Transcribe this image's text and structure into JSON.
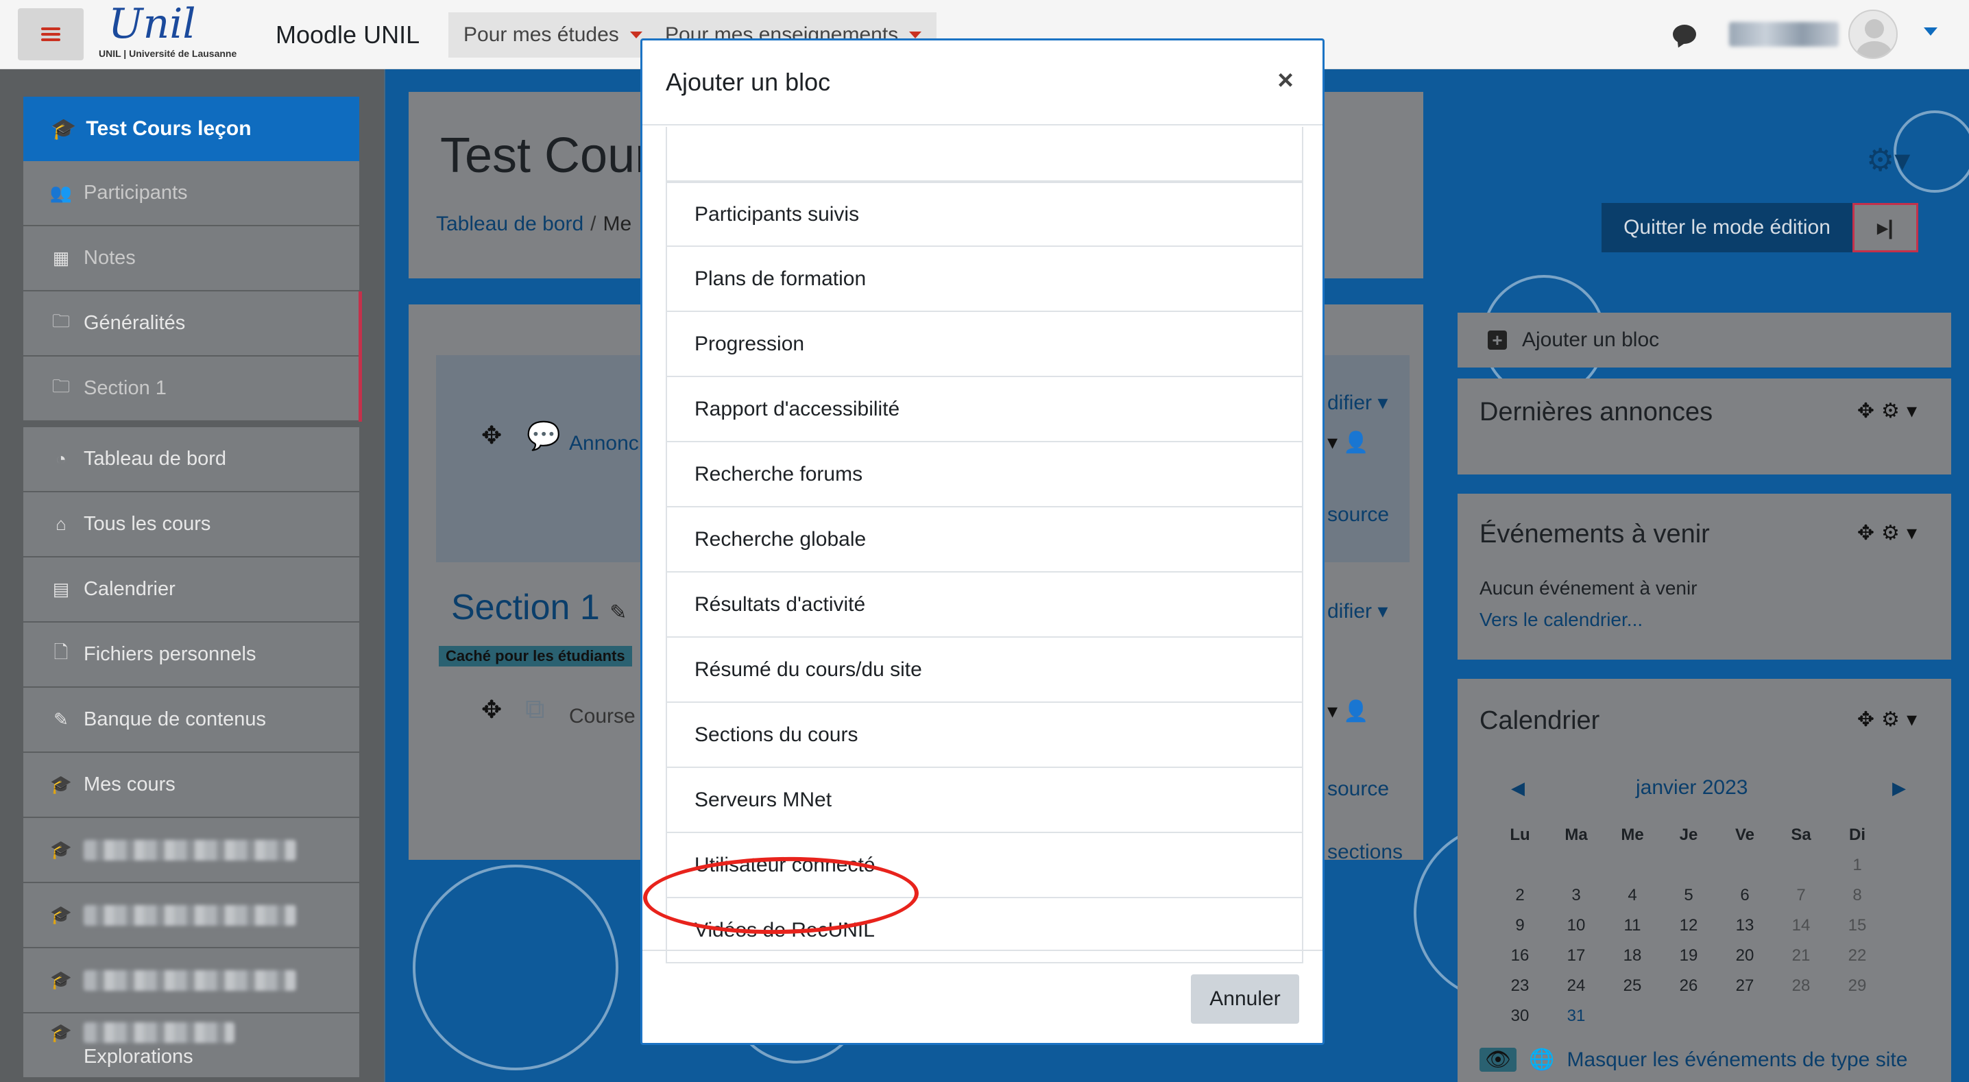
{
  "navbar": {
    "logo_text": "Unil",
    "logo_sub": "UNIL | Université de Lausanne",
    "site_name": "Moodle UNIL",
    "menu": [
      "Pour mes études",
      "Pour mes enseignements"
    ]
  },
  "drawer": {
    "course_title": "Test Cours leçon",
    "course_items": [
      {
        "label": "Participants",
        "icon": "users-icon"
      },
      {
        "label": "Notes",
        "icon": "table-icon"
      },
      {
        "label": "Généralités",
        "icon": "folder-icon"
      },
      {
        "label": "Section 1",
        "icon": "folder-icon"
      }
    ],
    "site_items": [
      {
        "label": "Tableau de bord",
        "icon": "dashboard-icon"
      },
      {
        "label": "Tous les cours",
        "icon": "home-icon"
      },
      {
        "label": "Calendrier",
        "icon": "calendar-icon"
      },
      {
        "label": "Fichiers personnels",
        "icon": "file-icon"
      },
      {
        "label": "Banque de contenus",
        "icon": "brush-icon"
      },
      {
        "label": "Mes cours",
        "icon": "graduation-cap-icon"
      }
    ],
    "last_item_label": "Explorations"
  },
  "page": {
    "course_title": "Test Cour",
    "breadcrumb_home": "Tableau de bord",
    "breadcrumb_next": "Me",
    "quit_edit": "Quitter le mode édition",
    "announcements_link": "Annonc",
    "section_title": "Section 1",
    "hidden_badge": "Caché pour les étudiants",
    "course_link": "Course",
    "right_modifier": "difier",
    "right_source": "source",
    "right_sections": "sections"
  },
  "blocks": {
    "add_block": "Ajouter un bloc",
    "announcements_title": "Dernières annonces",
    "events_title": "Événements à venir",
    "events_empty": "Aucun événement à venir",
    "events_link": "Vers le calendrier...",
    "calendar_title": "Calendrier",
    "calendar_month": "janvier 2023",
    "calendar_days": [
      "Lu",
      "Ma",
      "Me",
      "Je",
      "Ve",
      "Sa",
      "Di"
    ],
    "calendar_weeks": [
      [
        "",
        "",
        "",
        "",
        "",
        "",
        "1"
      ],
      [
        "2",
        "3",
        "4",
        "5",
        "6",
        "7",
        "8"
      ],
      [
        "9",
        "10",
        "11",
        "12",
        "13",
        "14",
        "15"
      ],
      [
        "16",
        "17",
        "18",
        "19",
        "20",
        "21",
        "22"
      ],
      [
        "23",
        "24",
        "25",
        "26",
        "27",
        "28",
        "29"
      ],
      [
        "30",
        "31",
        "",
        "",
        "",
        "",
        ""
      ]
    ],
    "hide_site_events": "Masquer les événements de type site"
  },
  "modal": {
    "title": "Ajouter un bloc",
    "close_symbol": "×",
    "items": [
      "Participants suivis",
      "Plans de formation",
      "Progression",
      "Rapport d'accessibilité",
      "Recherche forums",
      "Recherche globale",
      "Résultats d'activité",
      "Résumé du cours/du site",
      "Sections du cours",
      "Serveurs MNet",
      "Utilisateur connecté",
      "Vidéos de RecUNIL"
    ],
    "cancel": "Annuler",
    "highlighted_item": "Vidéos de RecUNIL",
    "highlight_color": "#e8231c"
  },
  "colors": {
    "primary": "#0f6cbf",
    "accent_red": "#ca3120",
    "section_marker": "#c4314b"
  }
}
